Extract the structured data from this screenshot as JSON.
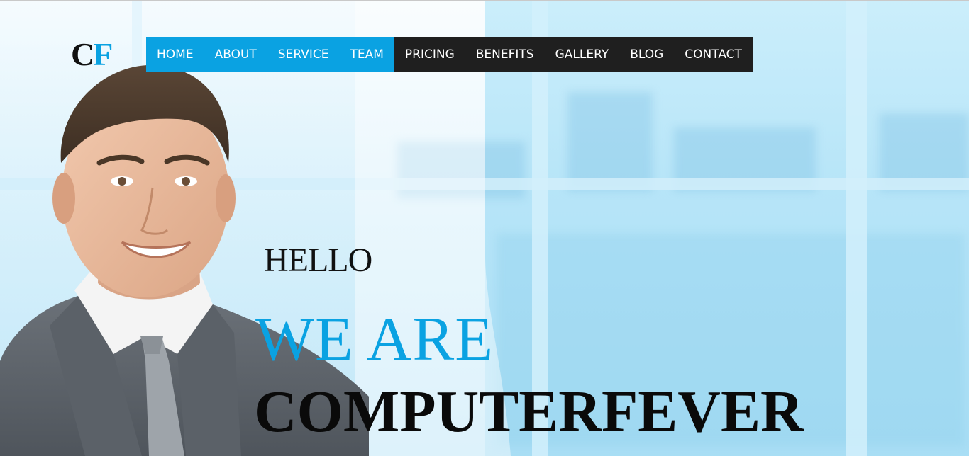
{
  "logo": {
    "part1": "C",
    "part2": "F"
  },
  "nav": {
    "primary": [
      "HOME",
      "ABOUT",
      "SERVICE",
      "TEAM"
    ],
    "secondary": [
      "PRICING",
      "BENEFITS",
      "GALLERY",
      "BLOG",
      "CONTACT"
    ]
  },
  "hero": {
    "greeting": "HELLO",
    "line1": "WE ARE",
    "line2": "COMPUTERFEVER"
  },
  "colors": {
    "accent": "#0aa2e2",
    "nav_dark": "#1f1f1f",
    "text_dark": "#111111"
  }
}
